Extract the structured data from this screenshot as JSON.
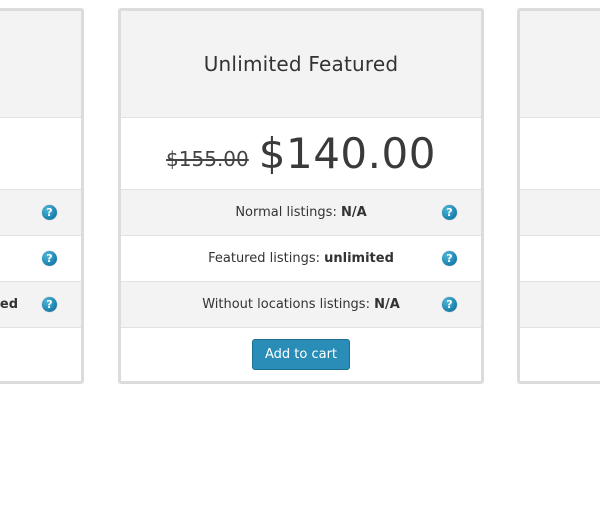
{
  "plans": {
    "left": {
      "partial_feature_text": "ted"
    },
    "center": {
      "title": "Unlimited Featured",
      "old_price": "$155.00",
      "new_price": "$140.00",
      "features": [
        {
          "label": "Normal listings:",
          "value": "N/A"
        },
        {
          "label": "Featured listings:",
          "value": "unlimited"
        },
        {
          "label": "Without locations listings:",
          "value": "N/A"
        }
      ],
      "add_to_cart_label": "Add to cart"
    }
  },
  "icons": {
    "help": "question-mark-icon",
    "help_glyph": "?"
  },
  "colors": {
    "accent": "#2a8db8",
    "header_bg": "#f3f3f3",
    "border": "#dcdcdc"
  }
}
